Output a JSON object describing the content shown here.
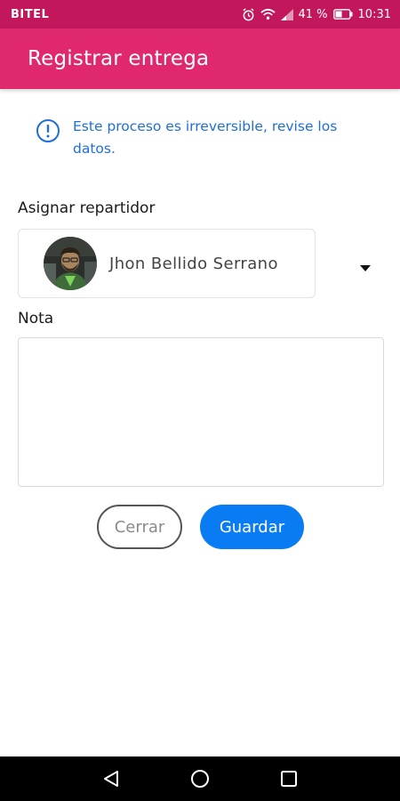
{
  "status_bar": {
    "carrier": "BITEL",
    "battery": "41 %",
    "time": "10:31"
  },
  "app_bar": {
    "title": "Registrar entrega"
  },
  "info": {
    "icon": "info-circle-icon",
    "message": "Este proceso es irreversible, revise los datos."
  },
  "assign": {
    "label": "Asignar repartidor",
    "selected_name": "Jhon Bellido Serrano",
    "dropdown_icon": "caret-down-icon"
  },
  "note": {
    "label": "Nota",
    "value": ""
  },
  "actions": {
    "close_label": "Cerrar",
    "save_label": "Guardar"
  },
  "colors": {
    "status_bar": "#c2185b",
    "app_bar": "#e0286e",
    "info_text": "#1e6fd9",
    "primary_button": "#0a7cf3"
  },
  "nav_bar": {
    "icons": [
      "back-icon",
      "home-icon",
      "recents-icon"
    ]
  }
}
